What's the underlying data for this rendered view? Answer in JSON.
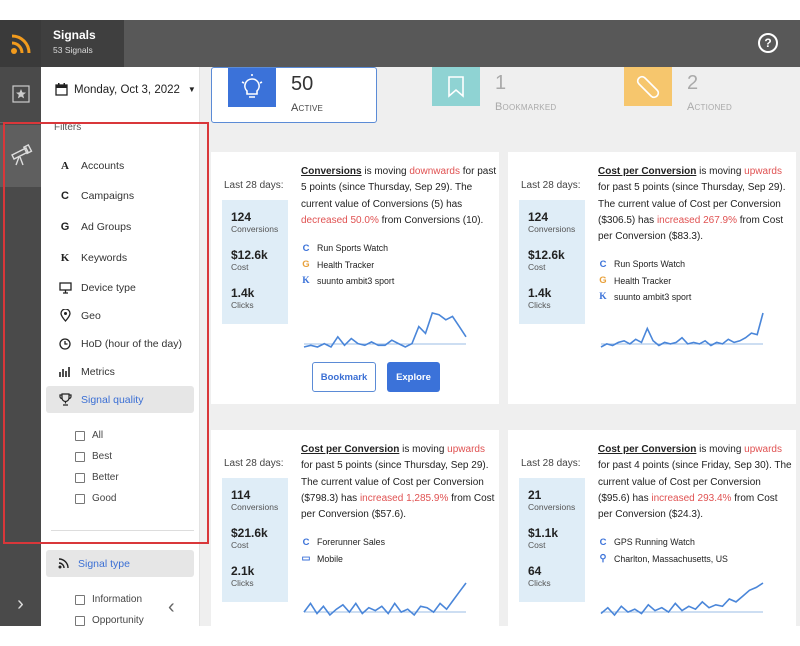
{
  "header": {
    "app_title": "Signals",
    "signal_count": "53 Signals",
    "help_label": "?"
  },
  "sidebar": {
    "date": "Monday, Oct 3, 2022",
    "filters_label": "Filters",
    "filters": [
      {
        "label": "Accounts",
        "icon": "accounts-icon",
        "glyph": "A"
      },
      {
        "label": "Campaigns",
        "icon": "campaigns-icon",
        "glyph": "C"
      },
      {
        "label": "Ad Groups",
        "icon": "ad-groups-icon",
        "glyph": "G"
      },
      {
        "label": "Keywords",
        "icon": "keywords-icon",
        "glyph": "K"
      },
      {
        "label": "Device type",
        "icon": "device-type-icon",
        "glyph": ""
      },
      {
        "label": "Geo",
        "icon": "geo-icon",
        "glyph": ""
      },
      {
        "label": "HoD (hour of the day)",
        "icon": "clock-icon",
        "glyph": ""
      },
      {
        "label": "Metrics",
        "icon": "metrics-icon",
        "glyph": ""
      },
      {
        "label": "Signal quality",
        "icon": "trophy-icon",
        "glyph": ""
      }
    ],
    "quality_options": [
      "All",
      "Best",
      "Better",
      "Good"
    ],
    "signal_type_label": "Signal type",
    "type_options": [
      "Information",
      "Opportunity"
    ],
    "collapse_glyph": "‹",
    "expand_glyph": "›"
  },
  "stats": [
    {
      "value": "50",
      "label": "Active",
      "color": "#3b72d9"
    },
    {
      "value": "1",
      "label": "Bookmarked",
      "color": "#8fd3d3"
    },
    {
      "value": "2",
      "label": "Actioned",
      "color": "#f6c66d"
    }
  ],
  "cards": [
    {
      "last28": "Last 28 days:",
      "metrics": [
        {
          "value": "124",
          "label": "Conversions"
        },
        {
          "value": "$12.6k",
          "label": "Cost"
        },
        {
          "value": "1.4k",
          "label": "Clicks"
        }
      ],
      "metric": "Conversions",
      "is_moving": " is moving ",
      "direction": "downwards",
      "for_text": " for past 5 points (since Thursday, Sep 29). The current value of Conversions (5) has ",
      "change": "decreased 50.0%",
      "tail": " from Conversions (10).",
      "tags": [
        {
          "icon": "C",
          "label": "Run Sports Watch",
          "color": "#3b72d9"
        },
        {
          "icon": "G",
          "label": "Health Tracker",
          "color": "#e8a13c"
        },
        {
          "icon": "K",
          "label": "suunto ambit3 sport",
          "color": "#3b72d9"
        }
      ],
      "spark": [
        8,
        9,
        8,
        10,
        8,
        14,
        9,
        13,
        10,
        9,
        11,
        9,
        9,
        12,
        10,
        8,
        10,
        20,
        16,
        28,
        27,
        24,
        26,
        20,
        14
      ],
      "bookmark_label": "Bookmark",
      "explore_label": "Explore"
    },
    {
      "last28": "Last 28 days:",
      "metrics": [
        {
          "value": "124",
          "label": "Conversions"
        },
        {
          "value": "$12.6k",
          "label": "Cost"
        },
        {
          "value": "1.4k",
          "label": "Clicks"
        }
      ],
      "metric": "Cost per Conversion",
      "is_moving": " is moving ",
      "direction": "upwards",
      "for_text": " for past 5 points (since Thursday, Sep 29). The current value of Cost per Conversion ($306.5) has ",
      "change": "increased 267.9%",
      "tail": " from Cost per Conversion ($83.3).",
      "tags": [
        {
          "icon": "C",
          "label": "Run Sports Watch",
          "color": "#3b72d9"
        },
        {
          "icon": "G",
          "label": "Health Tracker",
          "color": "#e8a13c"
        },
        {
          "icon": "K",
          "label": "suunto ambit3 sport",
          "color": "#3b72d9"
        }
      ],
      "spark": [
        6,
        8,
        7,
        9,
        10,
        8,
        11,
        9,
        18,
        10,
        7,
        9,
        8,
        9,
        12,
        8,
        9,
        8,
        10,
        7,
        9,
        8,
        11,
        9,
        10,
        12,
        15,
        14,
        28
      ]
    },
    {
      "last28": "Last 28 days:",
      "metrics": [
        {
          "value": "114",
          "label": "Conversions"
        },
        {
          "value": "$21.6k",
          "label": "Cost"
        },
        {
          "value": "2.1k",
          "label": "Clicks"
        }
      ],
      "metric": "Cost per Conversion",
      "is_moving": " is moving ",
      "direction": "upwards",
      "for_text": " for past 5 points (since Thursday, Sep 29). The current value of Cost per Conversion ($798.3) has ",
      "change": "increased 1,285.9%",
      "tail": " from Cost per Conversion ($57.6).",
      "tags": [
        {
          "icon": "C",
          "label": "Forerunner Sales",
          "color": "#3b72d9"
        },
        {
          "icon": "▭",
          "label": "Mobile",
          "color": "#3b72d9"
        }
      ],
      "spark": [
        6,
        12,
        5,
        10,
        4,
        8,
        11,
        6,
        12,
        5,
        9,
        7,
        10,
        5,
        12,
        6,
        8,
        4,
        10,
        9,
        6,
        12,
        8,
        14,
        20,
        26
      ]
    },
    {
      "last28": "Last 28 days:",
      "metrics": [
        {
          "value": "21",
          "label": "Conversions"
        },
        {
          "value": "$1.1k",
          "label": "Cost"
        },
        {
          "value": "64",
          "label": "Clicks"
        }
      ],
      "metric": "Cost per Conversion",
      "is_moving": " is moving ",
      "direction": "upwards",
      "for_text": " for past 4 points (since Friday, Sep 30). The current value of Cost per Conversion ($95.6) has ",
      "change": "increased 293.4%",
      "tail": " from Cost per Conversion ($24.3).",
      "tags": [
        {
          "icon": "C",
          "label": "GPS Running Watch",
          "color": "#3b72d9"
        },
        {
          "icon": "⚲",
          "label": "Charlton, Massachusetts, US",
          "color": "#3b72d9"
        }
      ],
      "spark": [
        4,
        8,
        3,
        9,
        5,
        7,
        4,
        10,
        6,
        8,
        5,
        11,
        6,
        9,
        7,
        12,
        8,
        10,
        9,
        14,
        12,
        16,
        20,
        22,
        25
      ]
    }
  ]
}
